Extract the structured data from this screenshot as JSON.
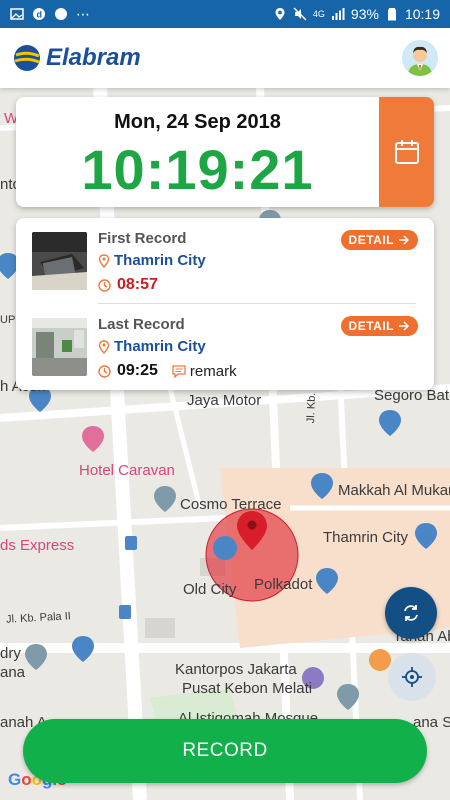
{
  "status_bar": {
    "battery": "93%",
    "time": "10:19",
    "network": "4G"
  },
  "header": {
    "logo_text": "Elabram"
  },
  "time_card": {
    "date": "Mon, 24 Sep 2018",
    "clock": "10:19:21"
  },
  "records": {
    "first": {
      "title": "First Record",
      "location": "Thamrin City",
      "time": "08:57",
      "detail_label": "DETAIL"
    },
    "last": {
      "title": "Last Record",
      "location": "Thamrin City",
      "time": "09:25",
      "remark": "remark",
      "detail_label": "DETAIL"
    }
  },
  "map": {
    "labels": {
      "jaya_motor": "Jaya Motor",
      "segoro": "Segoro Bati",
      "hotel_caravan": "Hotel Caravan",
      "cosmo_terrace": "Cosmo Terrace",
      "makkah": "Makkah Al Mukar",
      "thamrin_city": "Thamrin City",
      "ds_express": "ds Express",
      "old_city": "Old City",
      "polkadot": "Polkadot",
      "kb_pala": "Jl. Kb. Pala II",
      "kb_kacang": "Jl. Kb. Kacang",
      "kantorpos_1": "Kantorpos Jakarta",
      "kantorpos_2": "Pusat Kebon Melati",
      "tanah": "Tanah Ab Co",
      "al_istiqomah": "Al Istiqomah Mosque",
      "left_w": "W",
      "left_ntc": "ntc",
      "left_up": "UP",
      "left_ac": "h Aceh",
      "left_dry": "dry",
      "left_ana": "ana",
      "left_anah": "anah A",
      "right_ana": "ana S",
      "google": "Google"
    }
  },
  "buttons": {
    "record": "RECORD"
  },
  "colors": {
    "brand_blue": "#1565a8",
    "clock_green": "#1fa644",
    "accent_orange": "#f07a3a",
    "record_green": "#12b04a",
    "late_red": "#d01c1c"
  }
}
